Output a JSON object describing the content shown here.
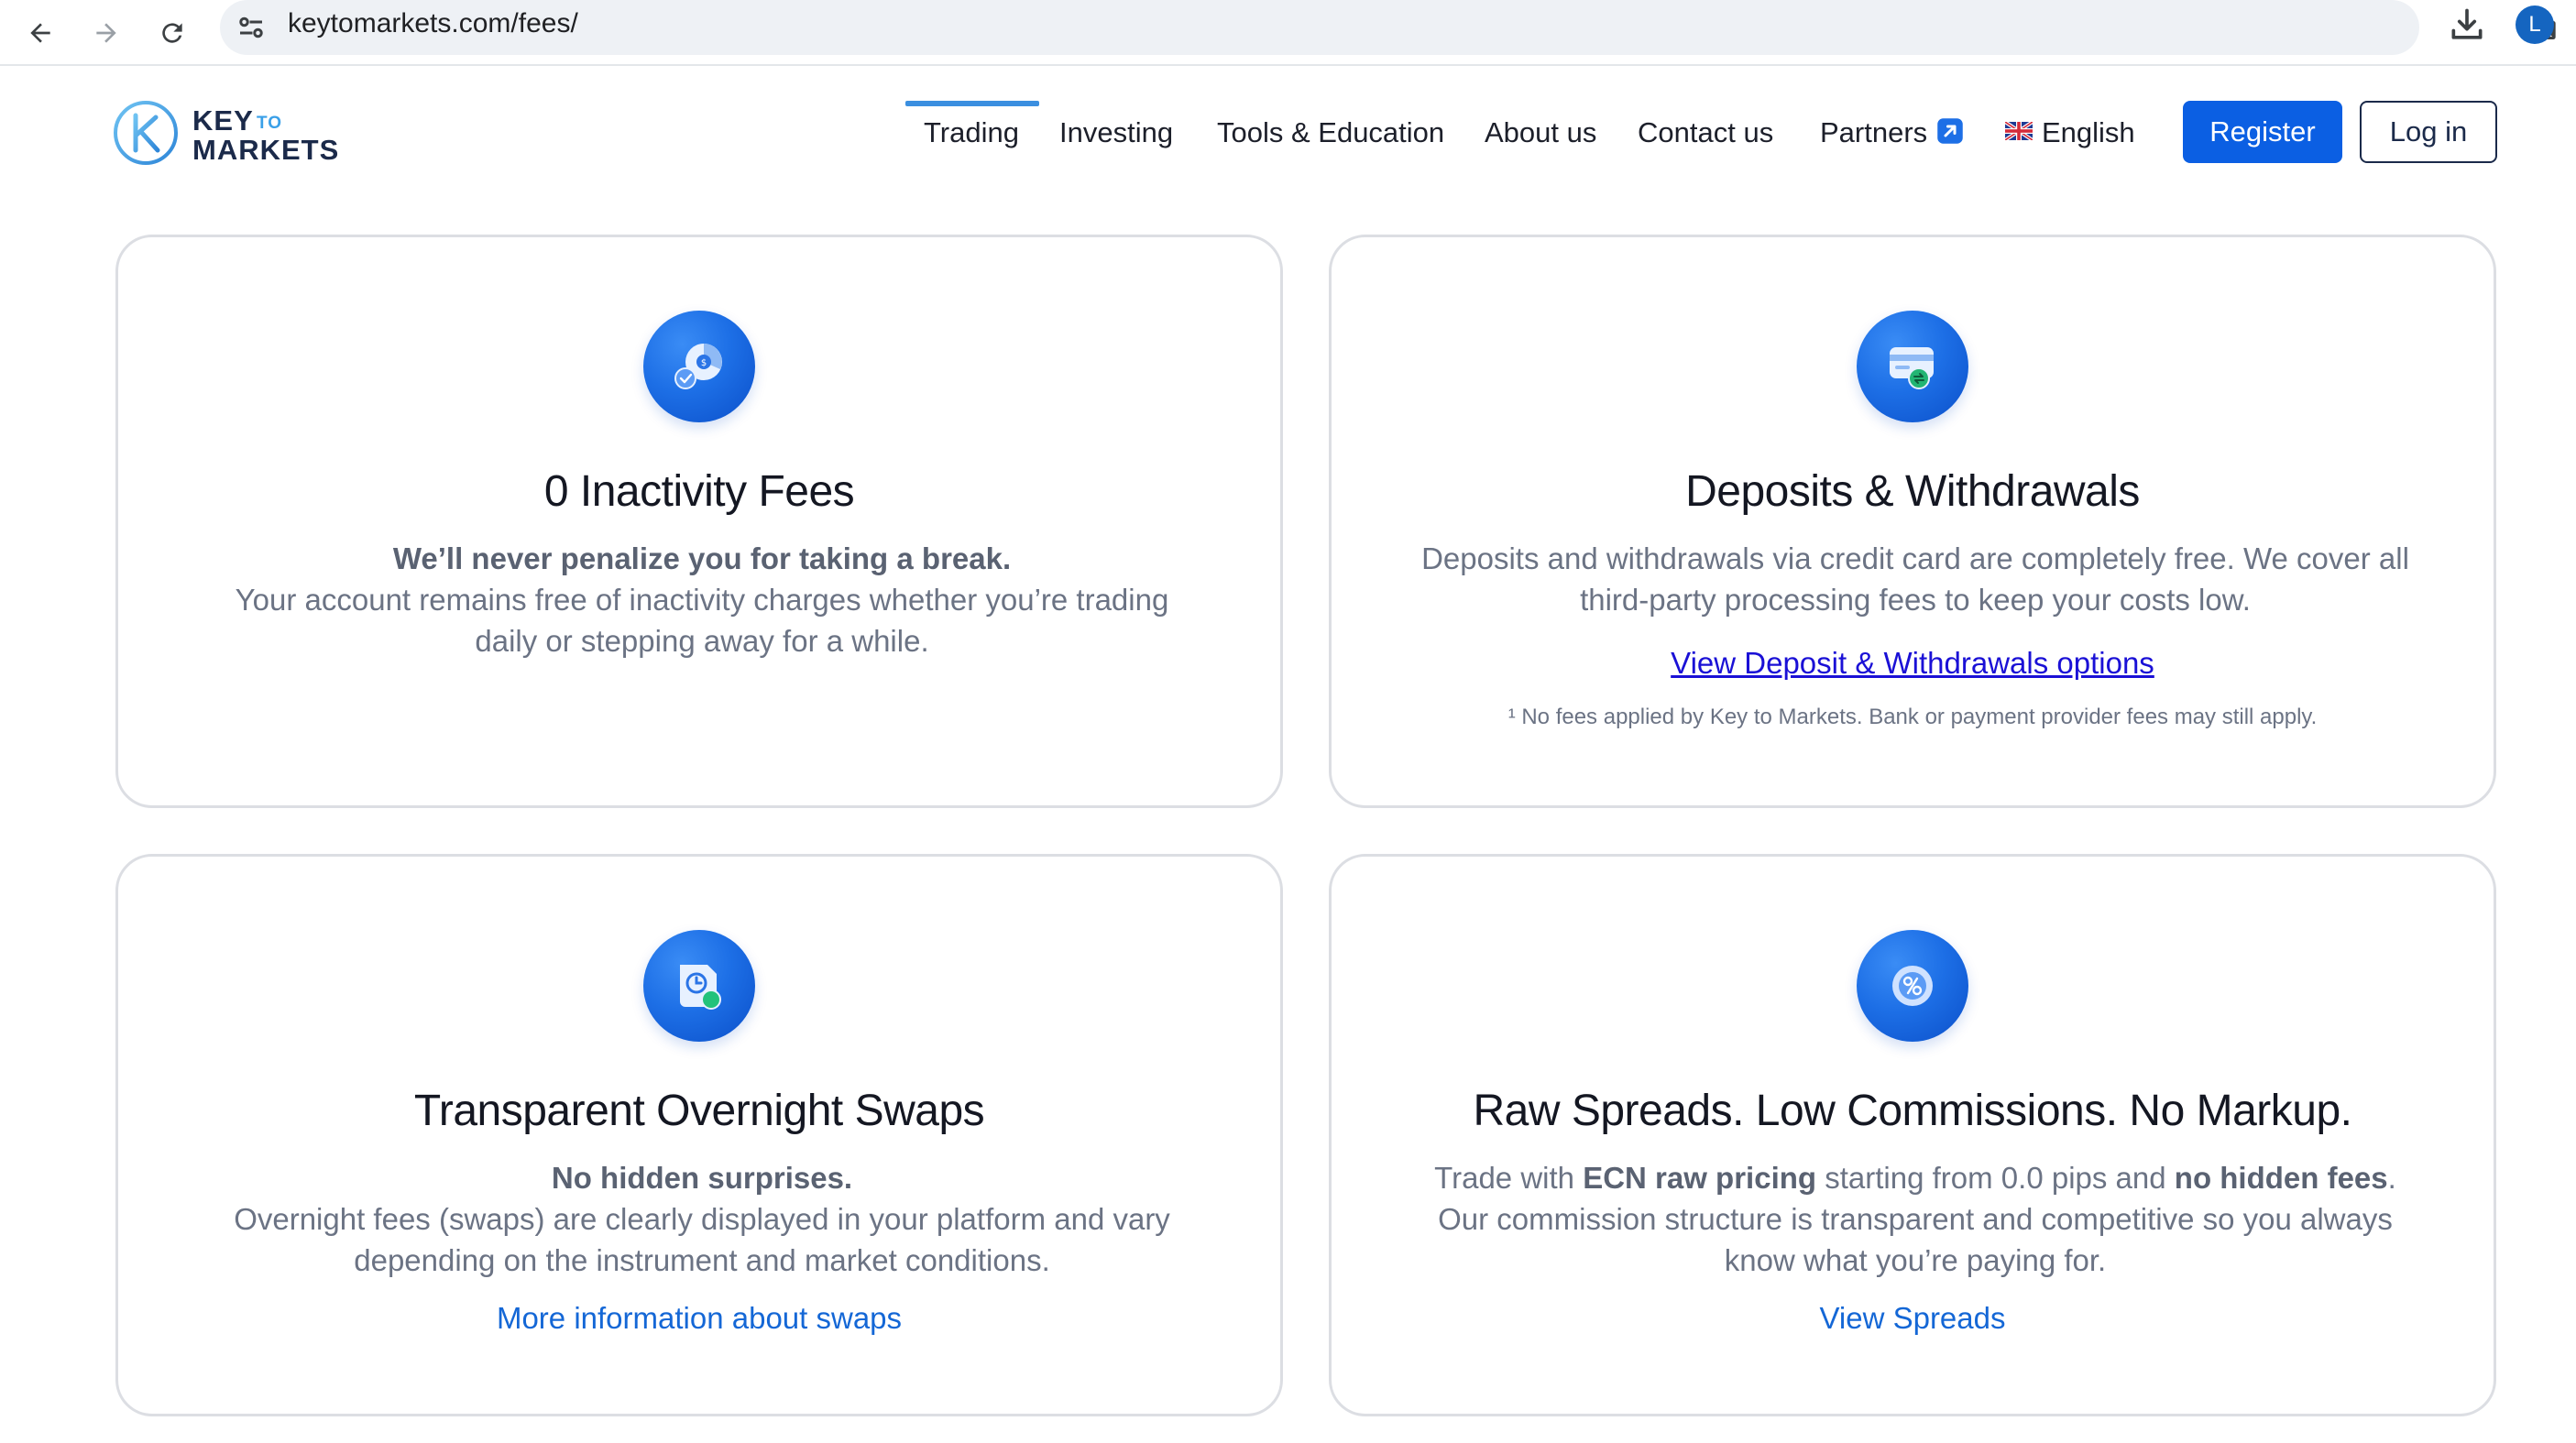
{
  "browser": {
    "url": "keytomarkets.com/fees/",
    "avatar_letter": "L"
  },
  "header": {
    "logo": {
      "word1": "KEY",
      "word2": "TO",
      "word3": "MARKETS"
    },
    "nav": [
      {
        "label": "Trading"
      },
      {
        "label": "Investing"
      },
      {
        "label": "Tools & Education"
      },
      {
        "label": "About us"
      },
      {
        "label": "Contact us"
      },
      {
        "label": "Partners"
      },
      {
        "label": "English"
      }
    ],
    "register_label": "Register",
    "login_label": "Log in"
  },
  "cards": [
    {
      "icon": "pie-chart-check-icon",
      "title": "0 Inactivity Fees",
      "lead": "We’ll never penalize you for taking a break.",
      "body": "Your account remains free of inactivity charges whether you’re trading daily or stepping away for a while."
    },
    {
      "icon": "wallet-card-icon",
      "title": "Deposits & Withdrawals",
      "body": "Deposits and withdrawals via credit card are completely free. We cover all third-party processing fees to keep your costs low.",
      "link": "View Deposit & Withdrawals options",
      "note": "¹ No fees applied by Key to Markets. Bank or payment provider fees may still apply."
    },
    {
      "icon": "clock-document-icon",
      "title": "Transparent Overnight Swaps",
      "lead": "No hidden surprises.",
      "body": "Overnight fees (swaps) are clearly displayed in your platform and vary depending on the instrument and market conditions.",
      "link": "More information about swaps"
    },
    {
      "icon": "coin-exchange-icon",
      "title": "Raw Spreads. Low Commissions. No Markup.",
      "body_parts": [
        "Trade with ",
        "ECN raw pricing",
        " starting from 0.0 pips and ",
        "no hidden fees",
        "."
      ],
      "body2": "Our commission structure is transparent and competitive so you always know what you’re paying for.",
      "link": "View Spreads"
    }
  ],
  "colors": {
    "accent": "#0b5fe3",
    "link": "#1467d6",
    "card_border": "#dcdee3",
    "body_text": "#6b7384"
  }
}
